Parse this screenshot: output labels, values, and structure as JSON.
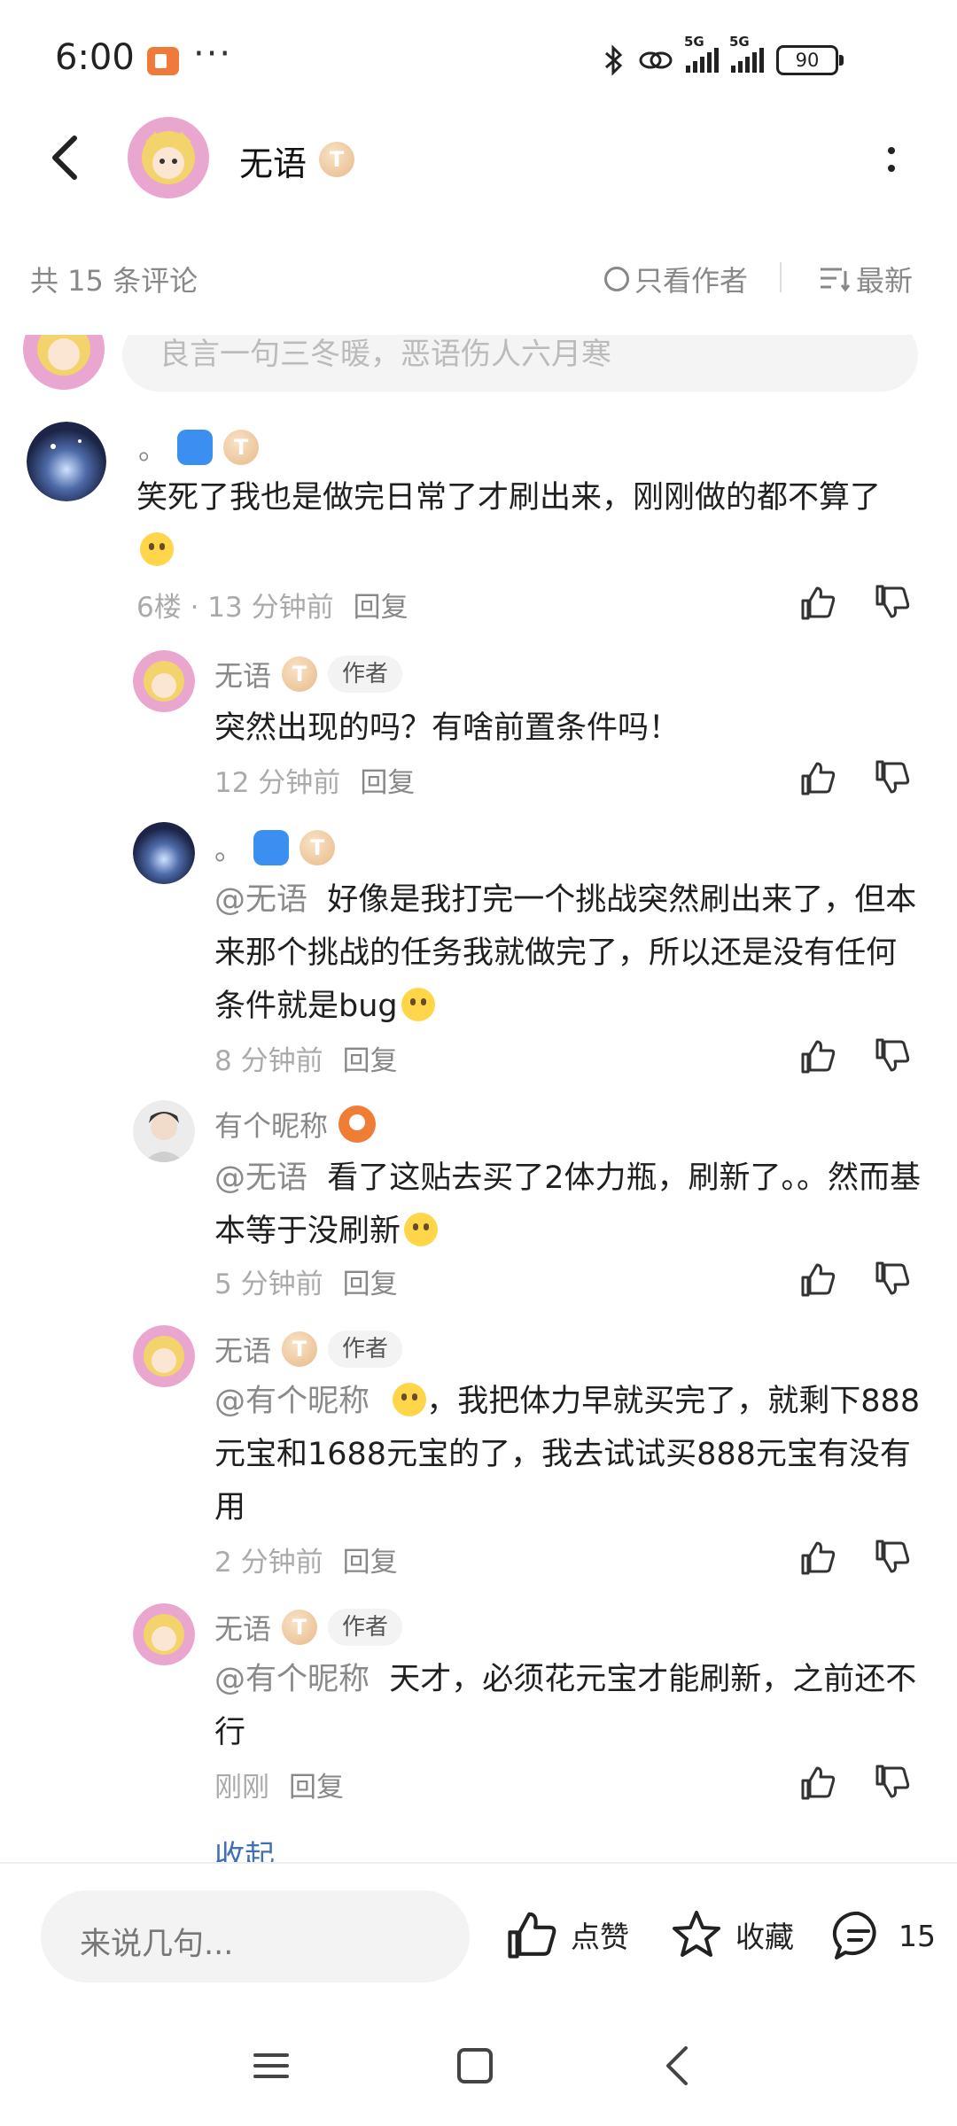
{
  "status_bar": {
    "time": "6:00",
    "dots": "···",
    "battery": "90",
    "net1": "5G",
    "net2": "5G"
  },
  "header": {
    "title": "无语",
    "badge": "T"
  },
  "toolbar": {
    "count": "共 15 条评论",
    "author_only": "只看作者",
    "sort": "最新"
  },
  "top_input": {
    "placeholder": "良言一句三冬暖，恶语伤人六月寒"
  },
  "comments": [
    {
      "name": "。",
      "text": "笑死了我也是做完日常了才刷出来，刚刚做的都不算了",
      "floor": "6楼 · 13 分钟前",
      "reply": "回复"
    },
    {
      "name": "无语",
      "author_tag": "作者",
      "text": "突然出现的吗？有啥前置条件吗！",
      "time": "12 分钟前",
      "reply": "回复"
    },
    {
      "name": "。",
      "mention": "@无语",
      "text": "好像是我打完一个挑战突然刷出来了，但本来那个挑战的任务我就做完了，所以还是没有任何条件就是bug",
      "time": "8 分钟前",
      "reply": "回复"
    },
    {
      "name": "有个昵称",
      "mention": "@无语",
      "text": "看了这贴去买了2体力瓶，刷新了。。然而基本等于没刷新",
      "time": "5 分钟前",
      "reply": "回复"
    },
    {
      "name": "无语",
      "author_tag": "作者",
      "mention": "@有个昵称",
      "text": "，我把体力早就买完了，就剩下888元宝和1688元宝的了，我去试试买888元宝有没有用",
      "time": "2 分钟前",
      "reply": "回复"
    },
    {
      "name": "无语",
      "author_tag": "作者",
      "mention": "@有个昵称",
      "text": "天才，必须花元宝才能刷新，之前还不行",
      "time": "刚刚",
      "reply": "回复"
    }
  ],
  "collapse_label": "收起",
  "bottom_bar": {
    "input_placeholder": "来说几句...",
    "like": "点赞",
    "favorite": "收藏",
    "comment_count": "15"
  },
  "colors": {
    "accent_link": "#3f6fb5",
    "game_tag": "#3b8ff0",
    "medal": "#f07d35",
    "app_icon": "#f07a3a"
  }
}
